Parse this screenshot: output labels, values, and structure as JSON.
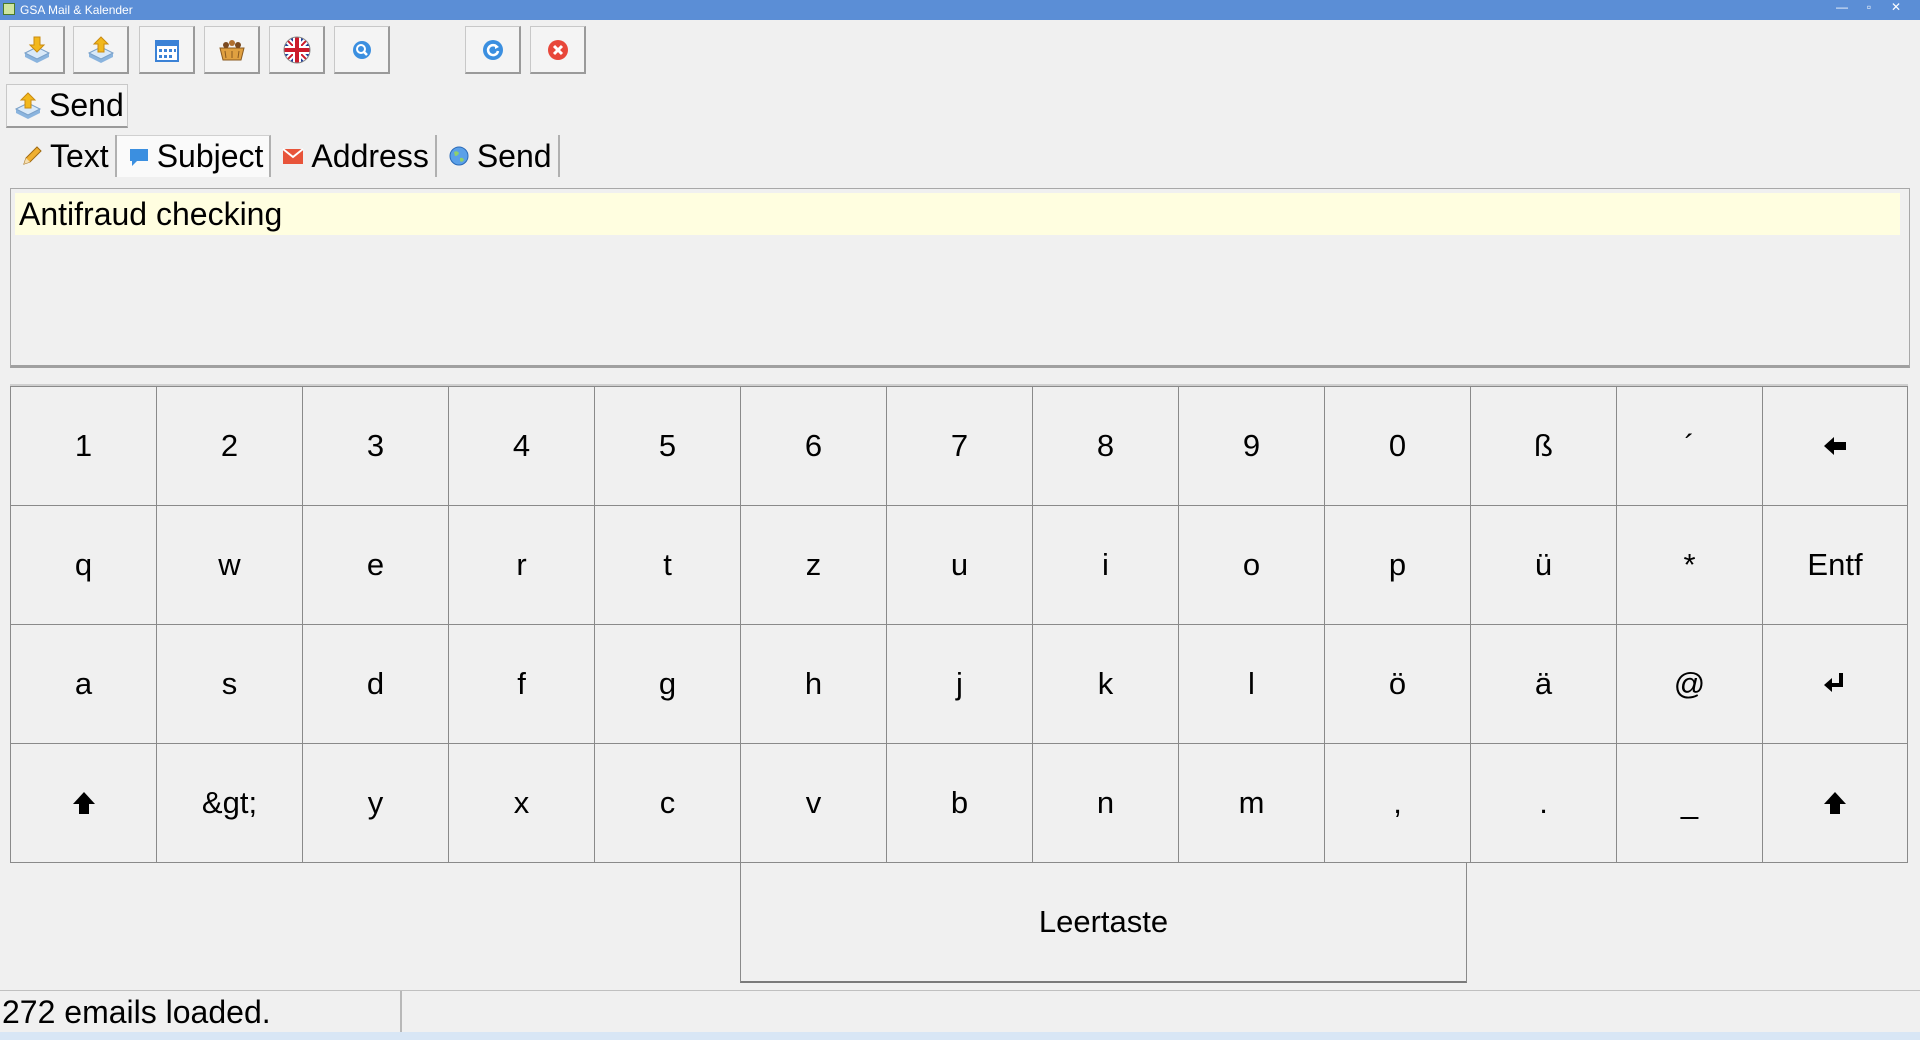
{
  "window": {
    "title": "GSA Mail & Kalender",
    "minimize_label": "—",
    "maximize_label": "▫",
    "close_label": "✕"
  },
  "toolbar": {
    "buttons": [
      {
        "name": "receive-button",
        "icon": "inbox-download-icon"
      },
      {
        "name": "send-mail-button",
        "icon": "outbox-upload-icon"
      },
      {
        "name": "calendar-button",
        "icon": "calendar-icon"
      },
      {
        "name": "addressbook-button",
        "icon": "basket-icon"
      },
      {
        "name": "language-button",
        "icon": "uk-flag-icon"
      },
      {
        "name": "search-button",
        "icon": "search-icon"
      },
      {
        "name": "refresh-button",
        "icon": "refresh-icon"
      },
      {
        "name": "close-app-button",
        "icon": "close-icon"
      }
    ]
  },
  "compose": {
    "send_label": "Send",
    "tabs": [
      {
        "label": "Text",
        "icon": "pencil-icon"
      },
      {
        "label": "Subject",
        "icon": "speech-bubble-icon"
      },
      {
        "label": "Address",
        "icon": "envelope-icon"
      },
      {
        "label": "Send",
        "icon": "globe-icon"
      }
    ],
    "active_tab": "Subject",
    "subject_value": "Antifraud checking"
  },
  "keyboard": {
    "rows": [
      [
        "1",
        "2",
        "3",
        "4",
        "5",
        "6",
        "7",
        "8",
        "9",
        "0",
        "ß",
        "´",
        "backspace"
      ],
      [
        "q",
        "w",
        "e",
        "r",
        "t",
        "z",
        "u",
        "i",
        "o",
        "p",
        "ü",
        "*",
        "Entf"
      ],
      [
        "a",
        "s",
        "d",
        "f",
        "g",
        "h",
        "j",
        "k",
        "l",
        "ö",
        "ä",
        "@",
        "enter"
      ],
      [
        "shift",
        "&gt;",
        "y",
        "x",
        "c",
        "v",
        "b",
        "n",
        "m",
        ",",
        ".",
        "_",
        "shift"
      ]
    ],
    "space_label": "Leertaste"
  },
  "status": {
    "message": "272 emails loaded."
  },
  "colors": {
    "titlebar": "#5b8ed6",
    "subject_bg": "#fffee0",
    "window_bg": "#f0f0f0"
  }
}
